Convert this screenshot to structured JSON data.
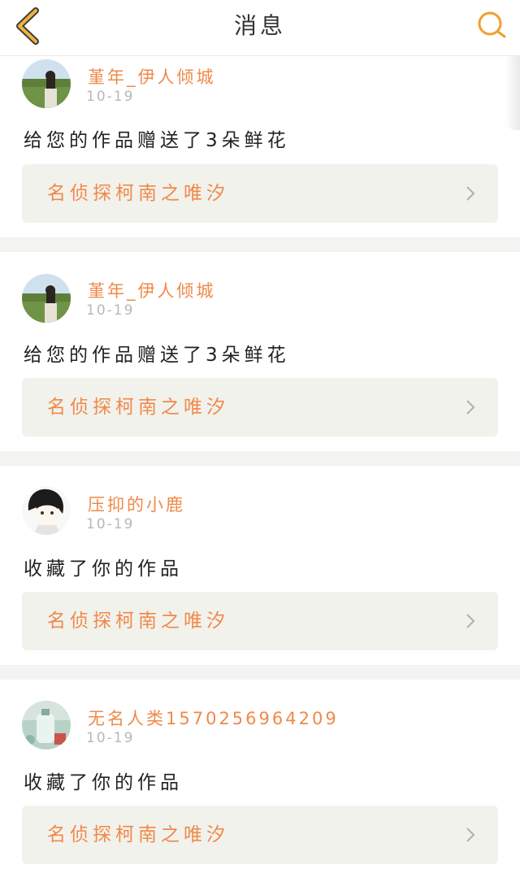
{
  "header": {
    "title": "消息",
    "back_icon": "chevron-left-icon",
    "search_icon": "search-icon",
    "accent_color": "#f0a030"
  },
  "messages": [
    {
      "username": "堇年_伊人倾城",
      "date": "10-19",
      "text": "给您的作品赠送了3朵鲜花",
      "work_title": "名侦探柯南之唯汐",
      "avatar": "girl-in-field-avatar"
    },
    {
      "username": "堇年_伊人倾城",
      "date": "10-19",
      "text": "给您的作品赠送了3朵鲜花",
      "work_title": "名侦探柯南之唯汐",
      "avatar": "girl-in-field-avatar"
    },
    {
      "username": "压抑的小鹿",
      "date": "10-19",
      "text": "收藏了你的作品",
      "work_title": "名侦探柯南之唯汐",
      "avatar": "anime-girl-sketch-avatar"
    },
    {
      "username": "无名人类1570256964209",
      "date": "10-19",
      "text": "收藏了你的作品",
      "work_title": "名侦探柯南之唯汐",
      "avatar": "bottle-photo-avatar"
    }
  ],
  "colors": {
    "username": "#f0894a",
    "work_title": "#f0894a",
    "date": "#b8b8b8",
    "card_bg": "#ffffff",
    "link_bg": "#f2f2ec",
    "page_bg": "#f3f3f1"
  }
}
